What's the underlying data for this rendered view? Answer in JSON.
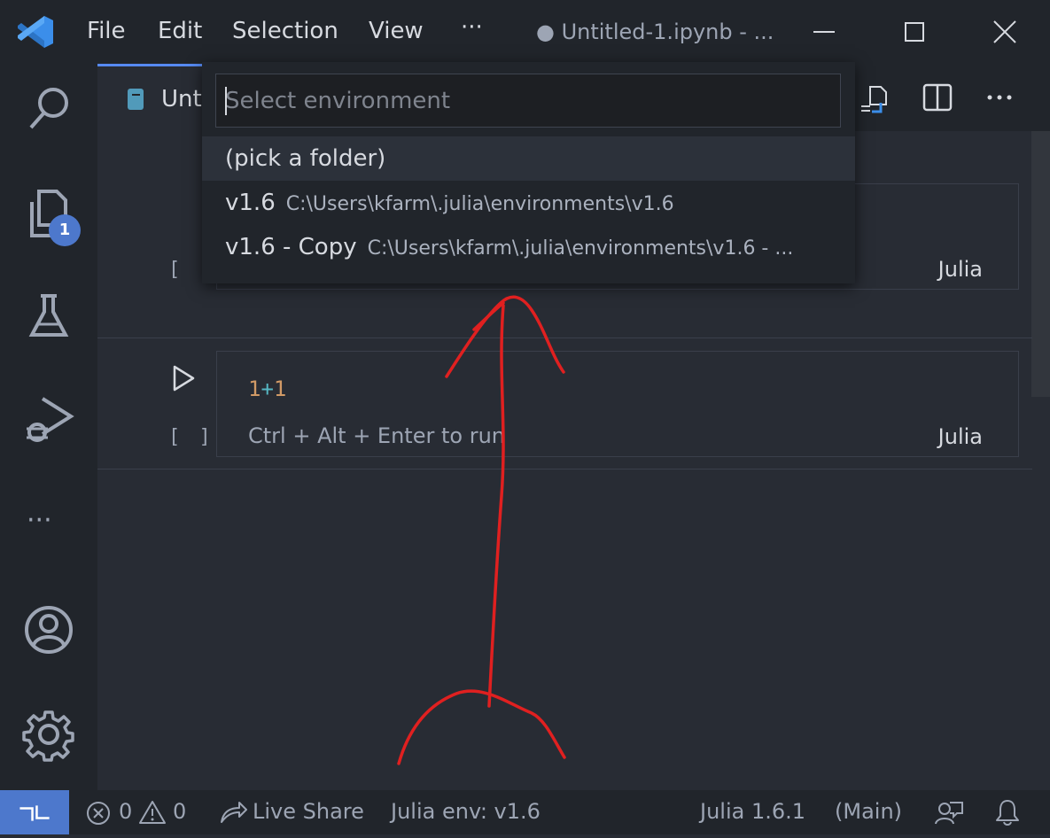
{
  "titlebar": {
    "menu": [
      "File",
      "Edit",
      "Selection",
      "View"
    ],
    "more": "···",
    "window_title": "● Untitled-1.ipynb - ..."
  },
  "activitybar": {
    "explorer_badge": "1",
    "more": "···"
  },
  "tab": {
    "label": "Unt"
  },
  "quickpick": {
    "placeholder": "Select environment",
    "items": [
      {
        "label": "(pick a folder)",
        "desc": ""
      },
      {
        "label": "v1.6",
        "desc": "C:\\Users\\kfarm\\.julia\\environments\\v1.6"
      },
      {
        "label": "v1.6 - Copy",
        "desc": "C:\\Users\\kfarm\\.julia\\environments\\v1.6 - ..."
      }
    ]
  },
  "cells": [
    {
      "bracket": "[ ]",
      "language": "Julia",
      "code_num1": "",
      "code_op": "",
      "code_num2": "",
      "hint": ""
    },
    {
      "bracket": "[ ]",
      "language": "Julia",
      "code_num1": "1",
      "code_op": "+",
      "code_num2": "1",
      "hint": "Ctrl + Alt + Enter to run"
    }
  ],
  "statusbar": {
    "errors": "0",
    "warnings": "0",
    "live_share": "Live Share",
    "julia_env": "Julia env: v1.6",
    "julia_version": "Julia 1.6.1",
    "branch": "(Main)"
  },
  "colors": {
    "accent": "#4d78cc",
    "annotation": "#e02020"
  }
}
